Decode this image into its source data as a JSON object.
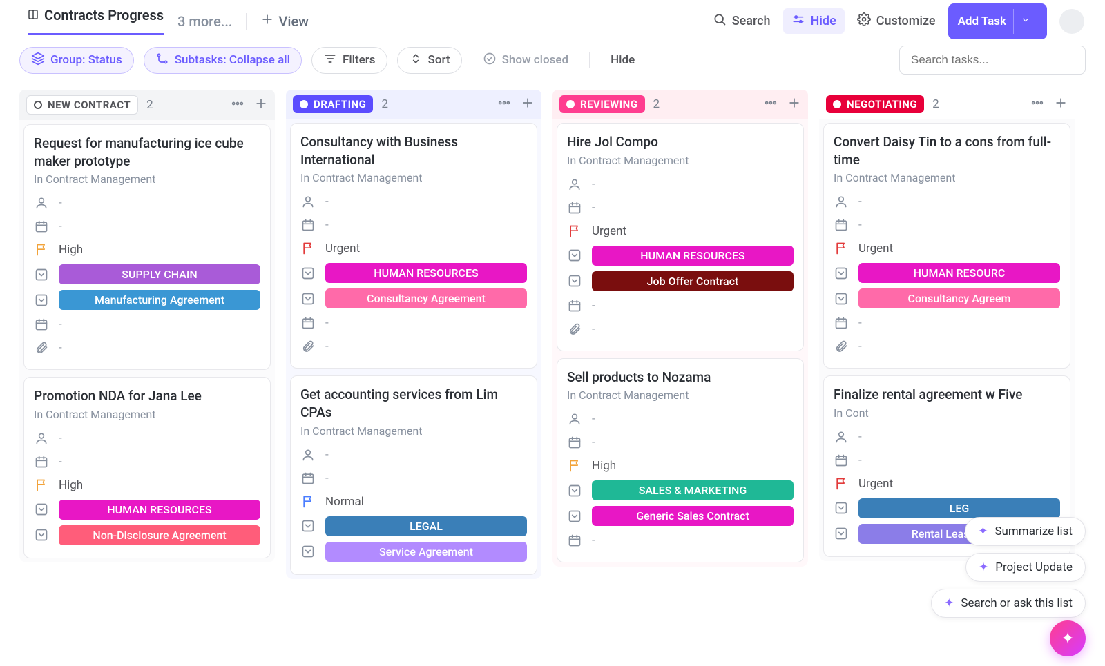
{
  "header": {
    "title": "Contracts Progress",
    "more": "3 more...",
    "addView": "View",
    "search": "Search",
    "hide": "Hide",
    "customize": "Customize",
    "addTask": "Add Task"
  },
  "filterbar": {
    "group": "Group: Status",
    "subtasks": "Subtasks: Collapse all",
    "filters": "Filters",
    "sort": "Sort",
    "showClosed": "Show closed",
    "hide": "Hide",
    "searchPlaceholder": "Search tasks..."
  },
  "columns": [
    {
      "name": "NEW CONTRACT",
      "count": "2",
      "style": "gray",
      "pill": "sp-gray",
      "cards": [
        {
          "title": "Request for manufacturing ice cube maker prototype",
          "sub": "In Contract Management",
          "assignee": "-",
          "date1": "-",
          "priority": {
            "label": "High",
            "color": "orange"
          },
          "tags": [
            {
              "label": "SUPPLY CHAIN",
              "class": "supply"
            },
            {
              "label": "Manufacturing Agreement",
              "class": "manuf"
            }
          ],
          "date2": "-",
          "attach": "-"
        },
        {
          "title": "Promotion NDA for Jana Lee",
          "sub": "In Contract Management",
          "assignee": "-",
          "date1": "-",
          "priority": {
            "label": "High",
            "color": "orange"
          },
          "tags": [
            {
              "label": "HUMAN RESOURCES",
              "class": "hr"
            },
            {
              "label": "Non-Disclosure Agreement",
              "class": "nda"
            }
          ]
        }
      ]
    },
    {
      "name": "DRAFTING",
      "count": "2",
      "style": "blue",
      "pill": "sp-blue",
      "cards": [
        {
          "title": "Consultancy with Business International",
          "sub": "In Contract Management",
          "assignee": "-",
          "date1": "-",
          "priority": {
            "label": "Urgent",
            "color": "red"
          },
          "tags": [
            {
              "label": "HUMAN RESOURCES",
              "class": "hr"
            },
            {
              "label": "Consultancy Agreement",
              "class": "consult"
            }
          ],
          "date2": "-",
          "attach": "-"
        },
        {
          "title": "Get accounting services from Lim CPAs",
          "sub": "In Contract Management",
          "assignee": "-",
          "date1": "-",
          "priority": {
            "label": "Normal",
            "color": "blue"
          },
          "tags": [
            {
              "label": "LEGAL",
              "class": "legal"
            },
            {
              "label": "Service Agreement",
              "class": "service"
            }
          ]
        }
      ]
    },
    {
      "name": "REVIEWING",
      "count": "2",
      "style": "pink",
      "pill": "sp-pink",
      "cards": [
        {
          "title": "Hire Jol Compo",
          "sub": "In Contract Management",
          "assignee": "-",
          "date1": "-",
          "priority": {
            "label": "Urgent",
            "color": "red"
          },
          "tags": [
            {
              "label": "HUMAN RESOURCES",
              "class": "hr"
            },
            {
              "label": "Job Offer Contract",
              "class": "joboffer"
            }
          ],
          "date2": "-",
          "attach": "-"
        },
        {
          "title": "Sell products to Nozama",
          "sub": "In Contract Management",
          "assignee": "-",
          "date1": "-",
          "priority": {
            "label": "High",
            "color": "orange"
          },
          "tags": [
            {
              "label": "SALES & MARKETING",
              "class": "sales"
            },
            {
              "label": "Generic Sales Contract",
              "class": "generic"
            }
          ],
          "date2": "-"
        }
      ]
    },
    {
      "name": "NEGOTIATING",
      "count": "2",
      "style": "purple",
      "pill": "sp-red",
      "cards": [
        {
          "title": "Convert Daisy Tin to a cons from full-time",
          "sub": "In Contract Management",
          "assignee": "-",
          "date1": "-",
          "priority": {
            "label": "Urgent",
            "color": "red"
          },
          "tags": [
            {
              "label": "HUMAN RESOURC",
              "class": "hr"
            },
            {
              "label": "Consultancy Agreem",
              "class": "consult"
            }
          ],
          "date2": "-",
          "attach": "-"
        },
        {
          "title": "Finalize rental agreement w Five",
          "sub": "In Cont",
          "assignee": "-",
          "date1": "-",
          "priority": {
            "label": "Urgent",
            "color": "red"
          },
          "tags": [
            {
              "label": "LEG",
              "class": "legal"
            },
            {
              "label": "Rental Lease Agree",
              "class": "rental"
            }
          ]
        }
      ]
    }
  ],
  "ai": {
    "summarize": "Summarize list",
    "project": "Project Update",
    "search": "Search or ask this list"
  }
}
